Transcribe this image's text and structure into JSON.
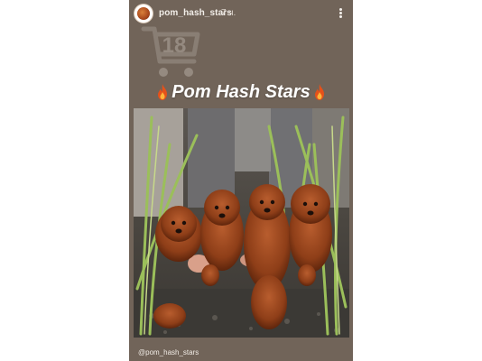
{
  "story": {
    "username": "pom_hash_stars",
    "timestamp": "7 ч.",
    "title": "Pom Hash Stars",
    "caption": "@pom_hash_stars",
    "icons": {
      "avatar": "avatar-icon",
      "more": "more-vertical-icon",
      "fire": "fire-icon",
      "watermark": "watermark-logo-icon"
    },
    "colors": {
      "background": "#716459",
      "title_text": "#ffffff",
      "fire": "#e8581c"
    }
  }
}
